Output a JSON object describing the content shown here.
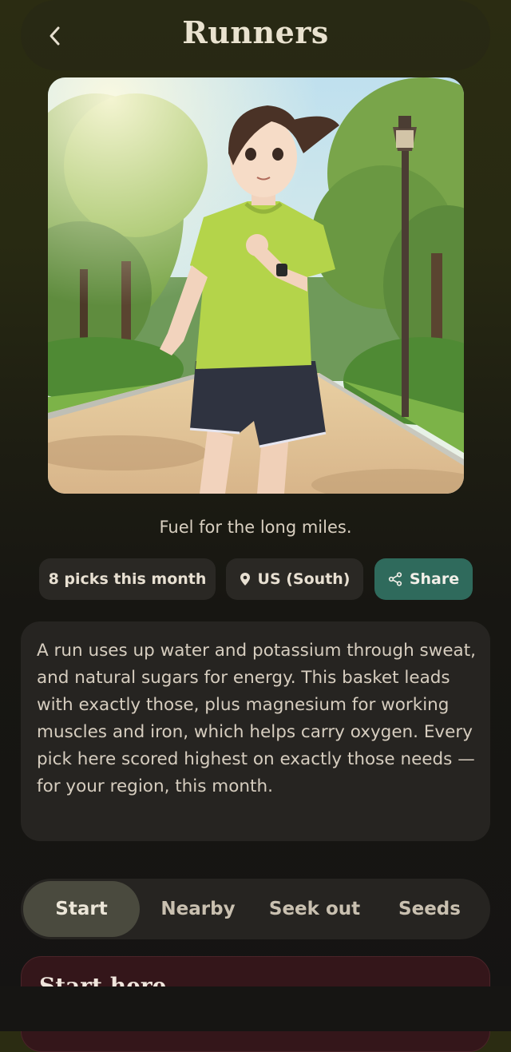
{
  "header": {
    "title": "Runners",
    "back_icon": "chevron-left-icon"
  },
  "hero": {
    "description": "Illustration of a woman jogging on a park path lined with trees"
  },
  "caption": "Fuel for the long miles.",
  "chips": {
    "picks": "8 picks this month",
    "region": "US (South)",
    "region_icon": "location-pin-icon",
    "share": "Share",
    "share_icon": "share-icon"
  },
  "description": "A run uses up water and potassium through sweat, and natural sugars for energy. This basket leads with exactly those, plus magnesium for working muscles and iron, which helps carry oxygen. Every pick here scored highest on exactly those needs — for your region, this month.",
  "tabs": [
    {
      "label": "Start",
      "active": true
    },
    {
      "label": "Nearby",
      "active": false
    },
    {
      "label": "Seek out",
      "active": false
    },
    {
      "label": "Seeds",
      "active": false
    }
  ],
  "start_card": {
    "heading": "Start here"
  },
  "colors": {
    "accent": "#2f6a5c",
    "card": "#262421",
    "start_card": "#34161a"
  }
}
